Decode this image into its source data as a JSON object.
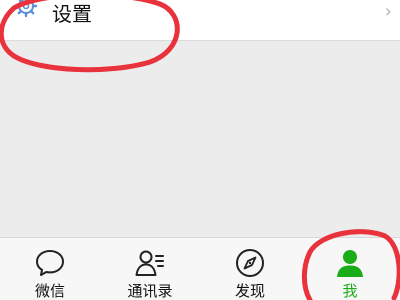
{
  "settings_row": {
    "label": "设置",
    "icon": "gear-icon",
    "chevron": "›"
  },
  "tab_bar": {
    "tabs": [
      {
        "label": "微信",
        "icon": "chat-bubble-icon",
        "active": false
      },
      {
        "label": "通讯录",
        "icon": "contacts-icon",
        "active": false
      },
      {
        "label": "发现",
        "icon": "compass-icon",
        "active": false
      },
      {
        "label": "我",
        "icon": "person-icon",
        "active": true
      }
    ]
  },
  "colors": {
    "accent": "#1aad19",
    "annotation": "#e8323c",
    "icon_blue": "#5b8fd6"
  }
}
